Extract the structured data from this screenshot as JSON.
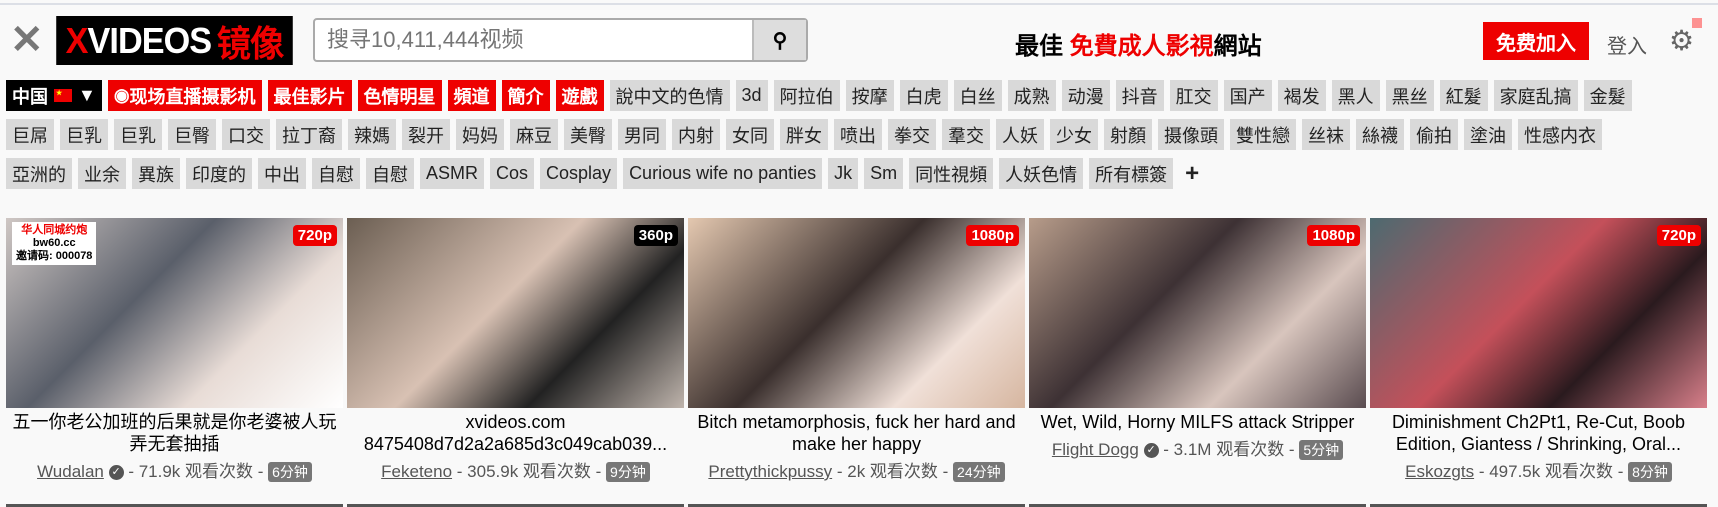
{
  "header": {
    "close_icon": "close-icon",
    "logo": {
      "x": "X",
      "videos": "VIDEOS",
      "mirror": "镜像"
    },
    "search": {
      "placeholder": "搜寻10,411,444视频",
      "icon": "search-icon"
    },
    "tagline": {
      "prefix": "最佳 ",
      "highlight": "免費成人影視",
      "suffix": "網站"
    },
    "join_label": "免费加入",
    "login_label": "登入",
    "settings_icon": "gear-icon"
  },
  "tags": {
    "country": "中国",
    "featured": [
      "现场直播摄影机",
      "最佳影片",
      "色情明星",
      "頻道",
      "簡介",
      "遊戲"
    ],
    "row1": [
      "說中文的色情",
      "3d",
      "阿拉伯",
      "按摩",
      "白虎",
      "白丝",
      "成熟",
      "动漫",
      "抖音",
      "肛交",
      "国产",
      "褐发",
      "黑人",
      "黑丝",
      "紅髮",
      "家庭乱搞",
      "金髮"
    ],
    "row2": [
      "巨屌",
      "巨乳",
      "巨乳",
      "巨臀",
      "口交",
      "拉丁裔",
      "辣媽",
      "裂开",
      "妈妈",
      "麻豆",
      "美臀",
      "男同",
      "内射",
      "女同",
      "胖女",
      "喷出",
      "拳交",
      "羣交",
      "人妖",
      "少女",
      "射顏",
      "摄像頭",
      "雙性戀",
      "丝袜",
      "絲襪",
      "偷拍",
      "塗油",
      "性感内衣"
    ],
    "row3": [
      "亞洲的",
      "业余",
      "異族",
      "印度的",
      "中出",
      "自慰",
      "自慰",
      "ASMR",
      "Cos",
      "Cosplay",
      "Curious wife no panties",
      "Jk",
      "Sm",
      "同性視頻",
      "人妖色情",
      "所有標簽"
    ],
    "more": "+"
  },
  "videos": [
    {
      "quality": "720p",
      "title": "五一你老公加班的后果就是你老婆被人玩弄无套抽插",
      "uploader": "Wudalan",
      "verified": true,
      "views": "71.9k 观看次数",
      "duration": "6分钟",
      "watermark": [
        "华人同城约炮",
        "bw60.cc",
        "邀请码: 000078"
      ]
    },
    {
      "quality": "360p",
      "title": "xvideos.com 8475408d7d2a2a685d3c049cab039...",
      "uploader": "Feketeno",
      "verified": false,
      "views": "305.9k 观看次数",
      "duration": "9分钟"
    },
    {
      "quality": "1080p",
      "title": "Bitch metamorphosis, fuck her hard and make her happy",
      "uploader": "Prettythickpussy",
      "verified": false,
      "views": "2k 观看次数",
      "duration": "24分钟"
    },
    {
      "quality": "1080p",
      "title": "Wet, Wild, Horny MILFS attack Stripper",
      "uploader": "Flight Dogg",
      "verified": true,
      "views": "3.1M 观看次数",
      "duration": "5分钟"
    },
    {
      "quality": "720p",
      "title": "Diminishment Ch2Pt1, Re-Cut, Boob Edition, Giantess / Shrinking, Oral...",
      "uploader": "Eskozgts",
      "verified": false,
      "views": "497.5k 观看次数",
      "duration": "8分钟"
    }
  ],
  "colors": {
    "brand_red": "#ee0000",
    "tag_gray": "#d9d9d9",
    "duration_gray": "#777777"
  }
}
